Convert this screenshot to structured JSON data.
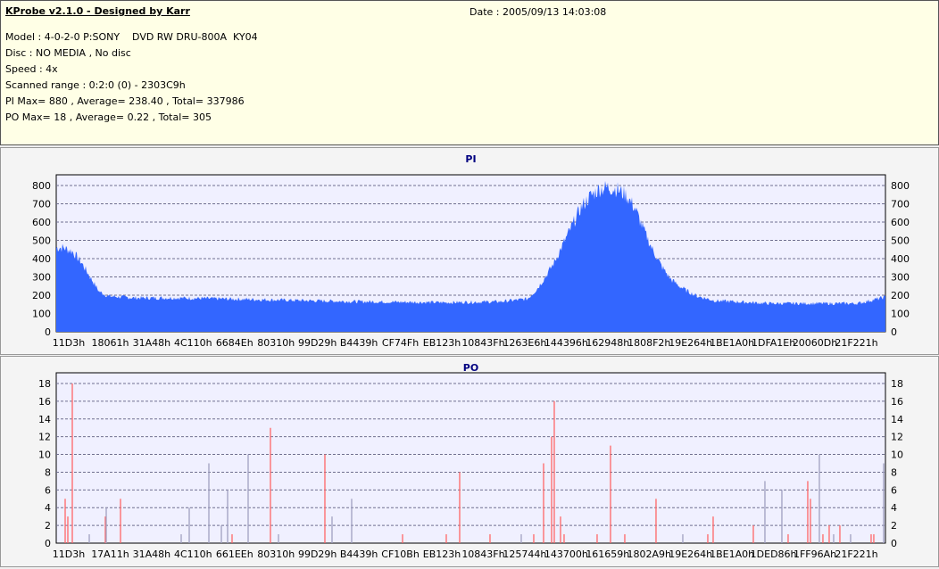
{
  "header": {
    "title": "KProbe v2.1.0 - Designed by Karr",
    "date": "Date : 2005/09/13 14:03:08",
    "lines": [
      "Model : 4-0-2-0 P:SONY    DVD RW DRU-800A  KY04",
      "Disc : NO MEDIA , No disc",
      "Speed : 4x",
      "Scanned range : 0:2:0 (0) - 2303C9h",
      "PI Max= 880 , Average= 238.40 , Total= 337986",
      "PO Max= 18 , Average= 0.22 , Total= 305"
    ]
  },
  "chart_data": [
    {
      "type": "area",
      "title": "PI",
      "ylim": [
        0,
        880
      ],
      "yticks": [
        0,
        100,
        200,
        300,
        400,
        500,
        600,
        700,
        800
      ],
      "xlim": [
        0,
        2294729
      ],
      "grid": true,
      "color": "#3366ff",
      "xticklabels": [
        "11D3h",
        "18061h",
        "31A48h",
        "4C110h",
        "6684Eh",
        "80310h",
        "99D29h",
        "B4439h",
        "CF74Fh",
        "EB123h",
        "10843Fh",
        "1263E6h",
        "144396h",
        "162948h",
        "1808F2h",
        "19E264h",
        "1BE1A0h",
        "1DFA1Eh",
        "20060Dh",
        "21F221h"
      ],
      "x": [
        0,
        19760,
        44460,
        69160,
        93860,
        118560,
        143260,
        217360,
        340860,
        587860,
        834860,
        1081860,
        1230060,
        1304160,
        1328860,
        1353560,
        1378260,
        1402960,
        1427660,
        1452360,
        1477060,
        1501760,
        1526460,
        1551160,
        1575860,
        1600560,
        1625260,
        1649960,
        1674660,
        1699360,
        1724060,
        1748760,
        1773460,
        1822860,
        1971060,
        2218060,
        2294729
      ],
      "values": [
        460,
        460,
        440,
        380,
        300,
        220,
        195,
        185,
        185,
        175,
        165,
        160,
        165,
        180,
        230,
        300,
        380,
        480,
        580,
        680,
        740,
        780,
        790,
        780,
        750,
        680,
        560,
        450,
        360,
        290,
        250,
        220,
        195,
        170,
        155,
        155,
        190
      ]
    },
    {
      "type": "bar",
      "title": "PO",
      "ylim": [
        0,
        18
      ],
      "yticks": [
        0,
        2,
        4,
        6,
        8,
        10,
        12,
        14,
        16,
        18
      ],
      "xlim": [
        0,
        2294729
      ],
      "grid": true,
      "xticklabels": [
        "11D3h",
        "17A11h",
        "31A48h",
        "4C110h",
        "661EEh",
        "80310h",
        "99D29h",
        "B4439h",
        "CF10Bh",
        "EB123h",
        "10843Fh",
        "125744h",
        "143700h",
        "161659h",
        "1802A9h",
        "19E264h",
        "1BE1A0h",
        "1DED86h",
        "1FF96Ah",
        "21F221h"
      ],
      "points": [
        [
          24700,
          5,
          "r"
        ],
        [
          32110,
          3,
          "r"
        ],
        [
          44460,
          18,
          "r"
        ],
        [
          91390,
          1,
          "g"
        ],
        [
          135850,
          3,
          "r"
        ],
        [
          138320,
          4,
          "g"
        ],
        [
          177840,
          5,
          "r"
        ],
        [
          345800,
          1,
          "g"
        ],
        [
          368030,
          4,
          "g"
        ],
        [
          422370,
          9,
          "g"
        ],
        [
          456950,
          2,
          "g"
        ],
        [
          474240,
          6,
          "g"
        ],
        [
          486590,
          1,
          "r"
        ],
        [
          531050,
          10,
          "g"
        ],
        [
          592800,
          13,
          "r"
        ],
        [
          615030,
          1,
          "g"
        ],
        [
          743470,
          10,
          "r"
        ],
        [
          763230,
          3,
          "g"
        ],
        [
          817570,
          5,
          "g"
        ],
        [
          958360,
          1,
          "r"
        ],
        [
          1079390,
          1,
          "r"
        ],
        [
          1116440,
          8,
          "r"
        ],
        [
          1200420,
          1,
          "r"
        ],
        [
          1286870,
          1,
          "g"
        ],
        [
          1321450,
          1,
          "r"
        ],
        [
          1348620,
          9,
          "r"
        ],
        [
          1370850,
          12,
          "r"
        ],
        [
          1378260,
          16,
          "r"
        ],
        [
          1395550,
          3,
          "r"
        ],
        [
          1405430,
          1,
          "r"
        ],
        [
          1496820,
          1,
          "r"
        ],
        [
          1533870,
          11,
          "r"
        ],
        [
          1573390,
          1,
          "r"
        ],
        [
          1659840,
          5,
          "r"
        ],
        [
          1733940,
          1,
          "g"
        ],
        [
          1803100,
          1,
          "r"
        ],
        [
          1817920,
          3,
          "r"
        ],
        [
          1929070,
          2,
          "r"
        ],
        [
          1961180,
          7,
          "g"
        ],
        [
          2008110,
          6,
          "g"
        ],
        [
          2025400,
          1,
          "r"
        ],
        [
          2079740,
          7,
          "r"
        ],
        [
          2087150,
          5,
          "r"
        ],
        [
          2111850,
          10,
          "g"
        ],
        [
          2121730,
          1,
          "r"
        ],
        [
          2139020,
          2,
          "r"
        ],
        [
          2151370,
          1,
          "g"
        ],
        [
          2168660,
          2,
          "r"
        ],
        [
          2198300,
          1,
          "g"
        ],
        [
          2255110,
          1,
          "r"
        ],
        [
          2262520,
          1,
          "r"
        ],
        [
          2289690,
          9,
          "g"
        ]
      ],
      "colors": {
        "r": "#ff6666",
        "g": "#a0a0c0"
      }
    }
  ]
}
